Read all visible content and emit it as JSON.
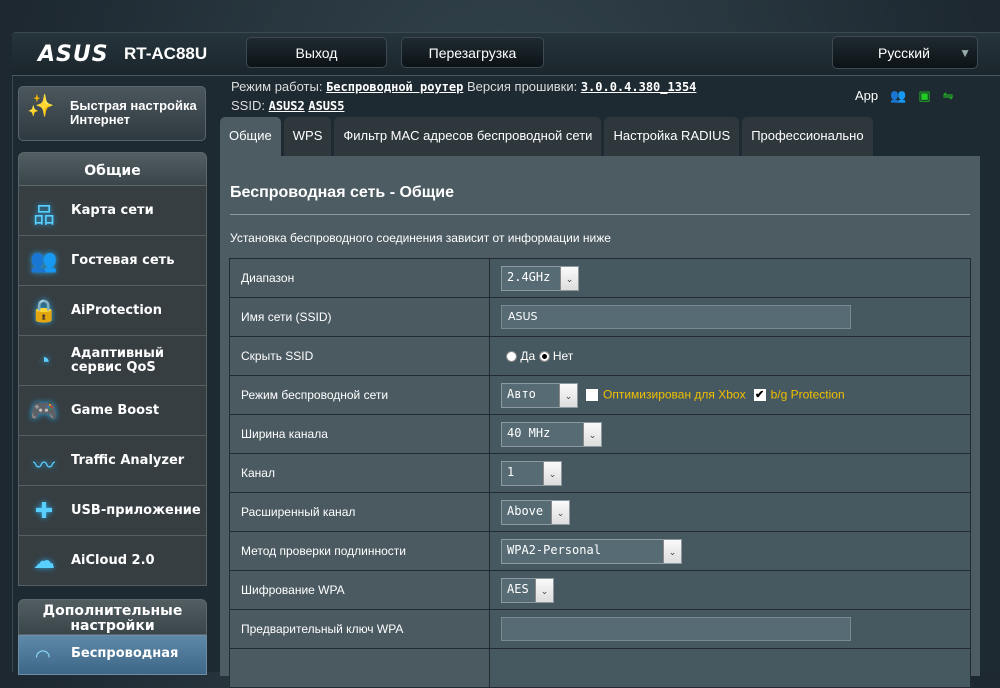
{
  "header": {
    "brand": "ASUS",
    "model": "RT-AC88U",
    "logout": "Выход",
    "reboot": "Перезагрузка",
    "language": "Русский"
  },
  "info": {
    "mode_label": "Режим работы:",
    "mode": "Беспроводной роутер",
    "fw_label": "Версия прошивки:",
    "fw": "3.0.0.4.380_1354",
    "ssid_label": "SSID:",
    "ssid1": "ASUS2",
    "ssid2": "ASUS5",
    "app": "App"
  },
  "quick_setup": {
    "line1": "Быстрая настройка",
    "line2": "Интернет"
  },
  "sidebar": {
    "general_title": "Общие",
    "items": [
      {
        "label": "Карта сети",
        "icon": "network-map-icon",
        "glyph": "品"
      },
      {
        "label": "Гостевая сеть",
        "icon": "guest-network-icon",
        "glyph": "👥"
      },
      {
        "label": "AiProtection",
        "icon": "lock-icon",
        "glyph": "🔒"
      },
      {
        "label": "Адаптивный сервис QoS",
        "icon": "speedometer-icon",
        "glyph": "◔"
      },
      {
        "label": "Game Boost",
        "icon": "gamepad-icon",
        "glyph": "🎮"
      },
      {
        "label": "Traffic Analyzer",
        "icon": "traffic-chart-icon",
        "glyph": "〰"
      },
      {
        "label": "USB-приложение",
        "icon": "puzzle-icon",
        "glyph": "✚"
      },
      {
        "label": "AiCloud 2.0",
        "icon": "cloud-home-icon",
        "glyph": "☁"
      }
    ],
    "advanced_title": "Дополнительные настройки",
    "active_item": "Беспроводная"
  },
  "tabs": [
    "Общие",
    "WPS",
    "Фильтр MAC адресов беспроводной сети",
    "Настройка RADIUS",
    "Профессионально"
  ],
  "main": {
    "title": "Беспроводная сеть - Общие",
    "description": "Установка беспроводного соединения зависит от информации ниже",
    "rows": {
      "band": {
        "label": "Диапазон",
        "value": "2.4GHz"
      },
      "ssid": {
        "label": "Имя сети (SSID)",
        "value": "ASUS"
      },
      "hide": {
        "label": "Скрыть SSID",
        "yes": "Да",
        "no": "Нет"
      },
      "mode": {
        "label": "Режим беспроводной сети",
        "value": "Авто",
        "xbox": "Оптимизирован для Xbox",
        "bg": "b/g Protection"
      },
      "width": {
        "label": "Ширина канала",
        "value": "40 MHz"
      },
      "channel": {
        "label": "Канал",
        "value": "1"
      },
      "ext": {
        "label": "Расширенный канал",
        "value": "Above"
      },
      "auth": {
        "label": "Метод проверки подлинности",
        "value": "WPA2-Personal"
      },
      "enc": {
        "label": "Шифрование WPA",
        "value": "AES"
      },
      "psk": {
        "label": "Предварительный ключ WPA",
        "value": ""
      }
    }
  }
}
